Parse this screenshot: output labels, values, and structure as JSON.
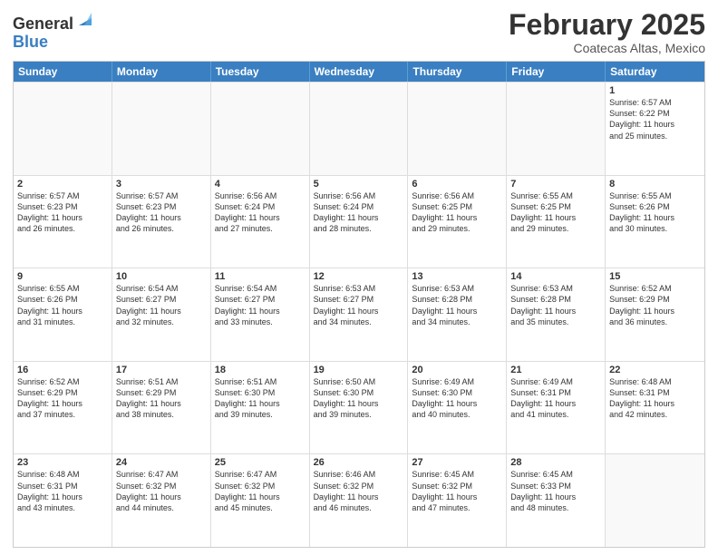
{
  "header": {
    "logo_line1": "General",
    "logo_line2": "Blue",
    "month_title": "February 2025",
    "location": "Coatecas Altas, Mexico"
  },
  "days_of_week": [
    "Sunday",
    "Monday",
    "Tuesday",
    "Wednesday",
    "Thursday",
    "Friday",
    "Saturday"
  ],
  "weeks": [
    [
      {
        "day": "",
        "text": ""
      },
      {
        "day": "",
        "text": ""
      },
      {
        "day": "",
        "text": ""
      },
      {
        "day": "",
        "text": ""
      },
      {
        "day": "",
        "text": ""
      },
      {
        "day": "",
        "text": ""
      },
      {
        "day": "1",
        "text": "Sunrise: 6:57 AM\nSunset: 6:22 PM\nDaylight: 11 hours\nand 25 minutes."
      }
    ],
    [
      {
        "day": "2",
        "text": "Sunrise: 6:57 AM\nSunset: 6:23 PM\nDaylight: 11 hours\nand 26 minutes."
      },
      {
        "day": "3",
        "text": "Sunrise: 6:57 AM\nSunset: 6:23 PM\nDaylight: 11 hours\nand 26 minutes."
      },
      {
        "day": "4",
        "text": "Sunrise: 6:56 AM\nSunset: 6:24 PM\nDaylight: 11 hours\nand 27 minutes."
      },
      {
        "day": "5",
        "text": "Sunrise: 6:56 AM\nSunset: 6:24 PM\nDaylight: 11 hours\nand 28 minutes."
      },
      {
        "day": "6",
        "text": "Sunrise: 6:56 AM\nSunset: 6:25 PM\nDaylight: 11 hours\nand 29 minutes."
      },
      {
        "day": "7",
        "text": "Sunrise: 6:55 AM\nSunset: 6:25 PM\nDaylight: 11 hours\nand 29 minutes."
      },
      {
        "day": "8",
        "text": "Sunrise: 6:55 AM\nSunset: 6:26 PM\nDaylight: 11 hours\nand 30 minutes."
      }
    ],
    [
      {
        "day": "9",
        "text": "Sunrise: 6:55 AM\nSunset: 6:26 PM\nDaylight: 11 hours\nand 31 minutes."
      },
      {
        "day": "10",
        "text": "Sunrise: 6:54 AM\nSunset: 6:27 PM\nDaylight: 11 hours\nand 32 minutes."
      },
      {
        "day": "11",
        "text": "Sunrise: 6:54 AM\nSunset: 6:27 PM\nDaylight: 11 hours\nand 33 minutes."
      },
      {
        "day": "12",
        "text": "Sunrise: 6:53 AM\nSunset: 6:27 PM\nDaylight: 11 hours\nand 34 minutes."
      },
      {
        "day": "13",
        "text": "Sunrise: 6:53 AM\nSunset: 6:28 PM\nDaylight: 11 hours\nand 34 minutes."
      },
      {
        "day": "14",
        "text": "Sunrise: 6:53 AM\nSunset: 6:28 PM\nDaylight: 11 hours\nand 35 minutes."
      },
      {
        "day": "15",
        "text": "Sunrise: 6:52 AM\nSunset: 6:29 PM\nDaylight: 11 hours\nand 36 minutes."
      }
    ],
    [
      {
        "day": "16",
        "text": "Sunrise: 6:52 AM\nSunset: 6:29 PM\nDaylight: 11 hours\nand 37 minutes."
      },
      {
        "day": "17",
        "text": "Sunrise: 6:51 AM\nSunset: 6:29 PM\nDaylight: 11 hours\nand 38 minutes."
      },
      {
        "day": "18",
        "text": "Sunrise: 6:51 AM\nSunset: 6:30 PM\nDaylight: 11 hours\nand 39 minutes."
      },
      {
        "day": "19",
        "text": "Sunrise: 6:50 AM\nSunset: 6:30 PM\nDaylight: 11 hours\nand 39 minutes."
      },
      {
        "day": "20",
        "text": "Sunrise: 6:49 AM\nSunset: 6:30 PM\nDaylight: 11 hours\nand 40 minutes."
      },
      {
        "day": "21",
        "text": "Sunrise: 6:49 AM\nSunset: 6:31 PM\nDaylight: 11 hours\nand 41 minutes."
      },
      {
        "day": "22",
        "text": "Sunrise: 6:48 AM\nSunset: 6:31 PM\nDaylight: 11 hours\nand 42 minutes."
      }
    ],
    [
      {
        "day": "23",
        "text": "Sunrise: 6:48 AM\nSunset: 6:31 PM\nDaylight: 11 hours\nand 43 minutes."
      },
      {
        "day": "24",
        "text": "Sunrise: 6:47 AM\nSunset: 6:32 PM\nDaylight: 11 hours\nand 44 minutes."
      },
      {
        "day": "25",
        "text": "Sunrise: 6:47 AM\nSunset: 6:32 PM\nDaylight: 11 hours\nand 45 minutes."
      },
      {
        "day": "26",
        "text": "Sunrise: 6:46 AM\nSunset: 6:32 PM\nDaylight: 11 hours\nand 46 minutes."
      },
      {
        "day": "27",
        "text": "Sunrise: 6:45 AM\nSunset: 6:32 PM\nDaylight: 11 hours\nand 47 minutes."
      },
      {
        "day": "28",
        "text": "Sunrise: 6:45 AM\nSunset: 6:33 PM\nDaylight: 11 hours\nand 48 minutes."
      },
      {
        "day": "",
        "text": ""
      }
    ]
  ]
}
